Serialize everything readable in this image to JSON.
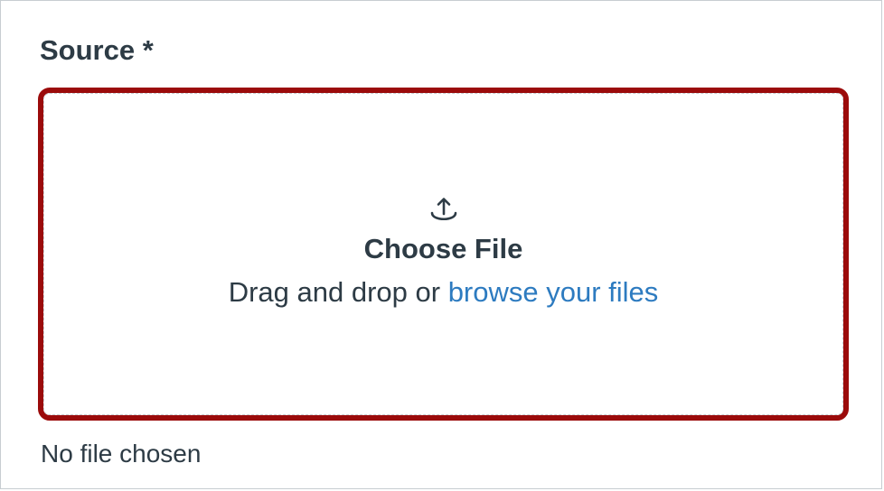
{
  "field": {
    "label": "Source *"
  },
  "dropzone": {
    "icon": "upload-icon",
    "title": "Choose File",
    "drag_text": "Drag and drop or ",
    "browse_link": "browse your files",
    "border_color": "#9b0b0b",
    "link_color": "#2d7bc0"
  },
  "status": {
    "text": "No file chosen"
  }
}
